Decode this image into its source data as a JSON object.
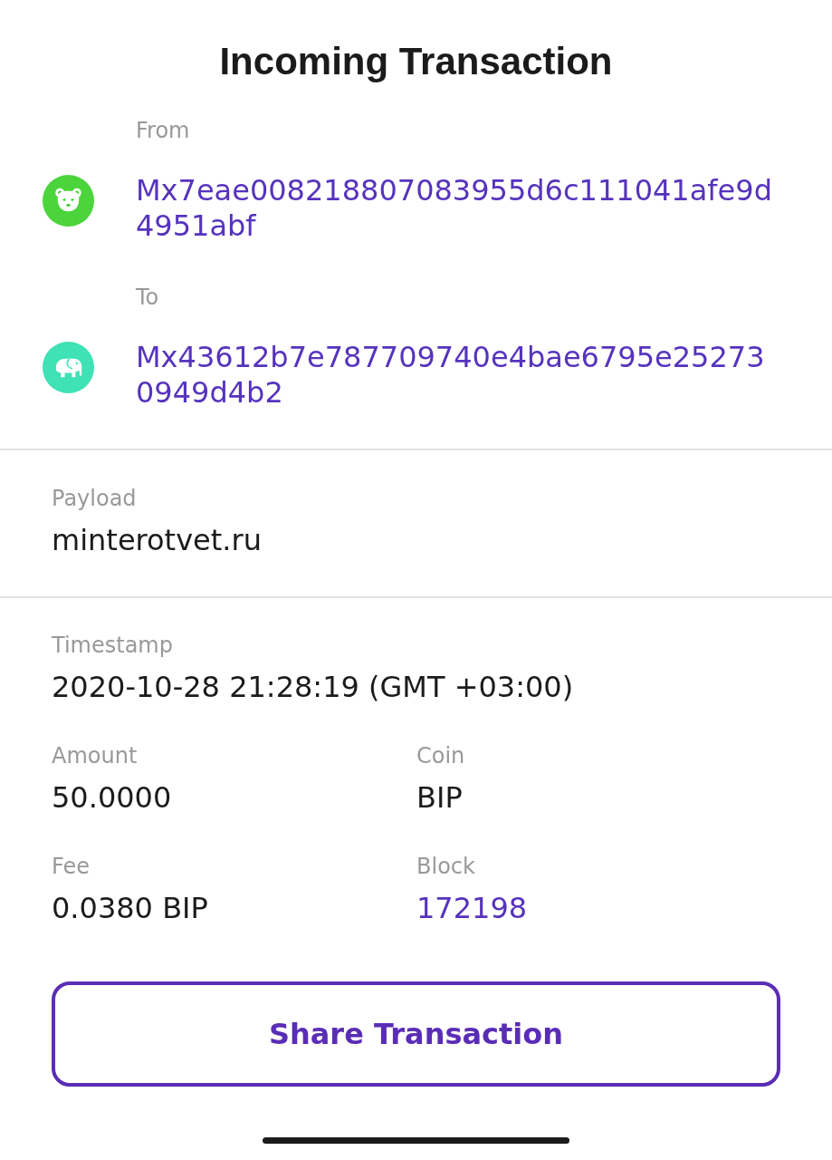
{
  "header": {
    "title": "Incoming Transaction"
  },
  "parties": [
    {
      "label": "From",
      "address": "Mx7eae008218807083955d6c111041afe9d4951abf",
      "kind": "bear",
      "color": "#4cd43c"
    },
    {
      "label": "To",
      "address": "Mx43612b7e787709740e4bae6795e252730949d4b2",
      "kind": "elephant",
      "color": "#3ee2b4"
    }
  ],
  "payload": {
    "label": "Payload",
    "value": "minterotvet.ru"
  },
  "timestamp": {
    "label": "Timestamp",
    "value": "2020-10-28 21:28:19 (GMT +03:00)"
  },
  "fields": [
    {
      "label": "Amount",
      "value": "50.0000",
      "kind": "text"
    },
    {
      "label": "Coin",
      "value": "BIP",
      "kind": "text"
    },
    {
      "label": "Fee",
      "value": "0.0380 BIP",
      "kind": "text"
    },
    {
      "label": "Block",
      "value": "172198",
      "kind": "link"
    }
  ],
  "share_button": {
    "label": "Share Transaction"
  }
}
